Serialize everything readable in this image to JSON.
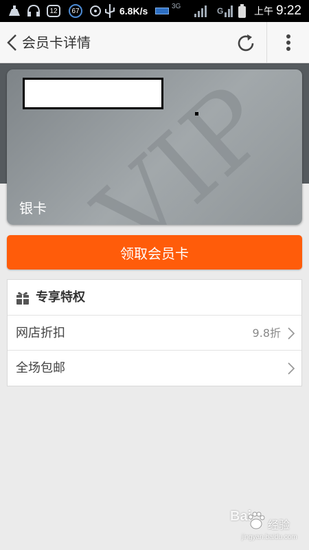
{
  "status_bar": {
    "badge_notifications": "12",
    "badge_count": "67",
    "network_speed": "6.8K/s",
    "network_type": "3G",
    "signal_type": "G",
    "ampm": "上午",
    "time": "9:22"
  },
  "header": {
    "title": "会员卡详情",
    "back_icon": "chevron-left-icon",
    "refresh_icon": "refresh-icon",
    "more_icon": "more-vertical-icon"
  },
  "card": {
    "watermark": "VIP",
    "level": "银卡"
  },
  "actions": {
    "get_card_label": "领取会员卡"
  },
  "privileges": {
    "title": "专享特权",
    "items": [
      {
        "label": "网店折扣",
        "value": "9.8折"
      },
      {
        "label": "全场包邮",
        "value": ""
      }
    ]
  },
  "watermark": {
    "brand": "Bai",
    "brand_suffix": "经验",
    "url": "jingyan.baidu.com"
  },
  "colors": {
    "accent": "#ff5c0a",
    "card": "#9aa0a3",
    "background": "#ebebeb"
  }
}
